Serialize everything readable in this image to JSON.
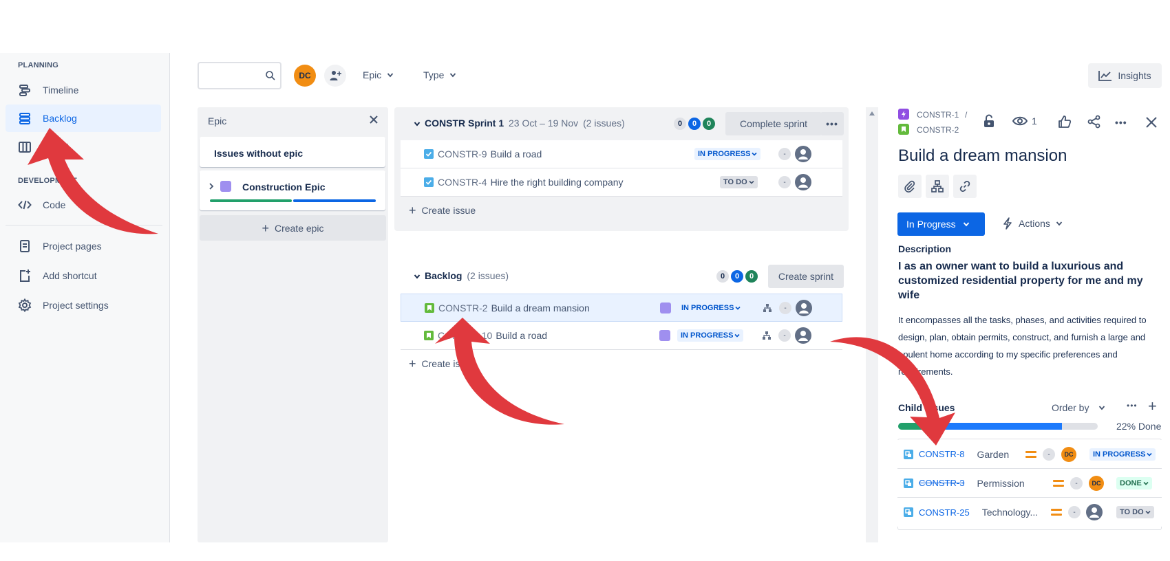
{
  "sidebar": {
    "planning_label": "PLANNING",
    "development_label": "DEVELOPMENT",
    "items": [
      {
        "label": "Timeline",
        "icon": "timeline-icon"
      },
      {
        "label": "Backlog",
        "icon": "backlog-icon",
        "active": true
      },
      {
        "label": "Board",
        "icon": "board-icon"
      },
      {
        "label": "Code",
        "icon": "code-icon"
      },
      {
        "label": "Project pages",
        "icon": "page-icon"
      },
      {
        "label": "Add shortcut",
        "icon": "add-shortcut-icon"
      },
      {
        "label": "Project settings",
        "icon": "gear-icon"
      }
    ]
  },
  "toolbar": {
    "search_placeholder": "",
    "user_initials": "DC",
    "epic_filter": "Epic",
    "type_filter": "Type",
    "insights_label": "Insights"
  },
  "epic_panel": {
    "title": "Epic",
    "without_epic": "Issues without epic",
    "epics": [
      {
        "name": "Construction Epic",
        "color": "#9f8fef"
      }
    ],
    "create_label": "Create epic"
  },
  "sprint": {
    "name": "CONSTR Sprint 1",
    "dates": "23 Oct – 19 Nov",
    "count": "(2 issues)",
    "counts": [
      "0",
      "0",
      "0"
    ],
    "complete_label": "Complete sprint",
    "issues": [
      {
        "key": "CONSTR-9",
        "summary": "Build a road",
        "status": "IN PROGRESS",
        "estimate": "-"
      },
      {
        "key": "CONSTR-4",
        "summary": "Hire the right building company",
        "status": "TO DO",
        "estimate": "-"
      }
    ],
    "create_issue": "Create issue"
  },
  "backlog": {
    "name": "Backlog",
    "count": "(2 issues)",
    "counts": [
      "0",
      "0",
      "0"
    ],
    "create_sprint": "Create sprint",
    "issues": [
      {
        "key": "CONSTR-2",
        "summary": "Build a dream mansion",
        "status": "IN PROGRESS",
        "estimate": "-"
      },
      {
        "key": "CONSTR-10",
        "summary": "Build a road",
        "status": "IN PROGRESS",
        "estimate": "-"
      }
    ],
    "create_issue": "Create issue"
  },
  "detail": {
    "breadcrumb_parent": "CONSTR-1",
    "breadcrumb_sep": "/",
    "breadcrumb_current": "CONSTR-2",
    "watch_count": "1",
    "title": "Build a dream mansion",
    "status_label": "In Progress",
    "actions_label": "Actions",
    "description_heading": "Description",
    "description_bold": "I as an owner want to build a luxurious and customized residential property for me and my wife",
    "description_body": "It encompasses all the tasks, phases, and activities required to design, plan, obtain permits, construct, and furnish a large and opulent home according to my specific preferences and requirements.",
    "child_heading": "Child issues",
    "order_by": "Order by",
    "progress_done_fraction": 0.22,
    "progress_label": "22% Done",
    "children": [
      {
        "key": "CONSTR-8",
        "summary": "Garden",
        "status": "IN PROGRESS",
        "assignee": "DC",
        "strike": false
      },
      {
        "key": "CONSTR-3",
        "summary": "Permission",
        "status": "DONE",
        "assignee": "DC",
        "strike": true
      },
      {
        "key": "CONSTR-25",
        "summary": "Technology...",
        "status": "TO DO",
        "assignee": "",
        "strike": false
      }
    ]
  },
  "colors": {
    "accent": "#0c66e4",
    "annotation_arrow": "#e0393e",
    "story_green": "#63ba3c",
    "task_blue": "#4bade8",
    "avatar_orange": "#f18d13"
  }
}
